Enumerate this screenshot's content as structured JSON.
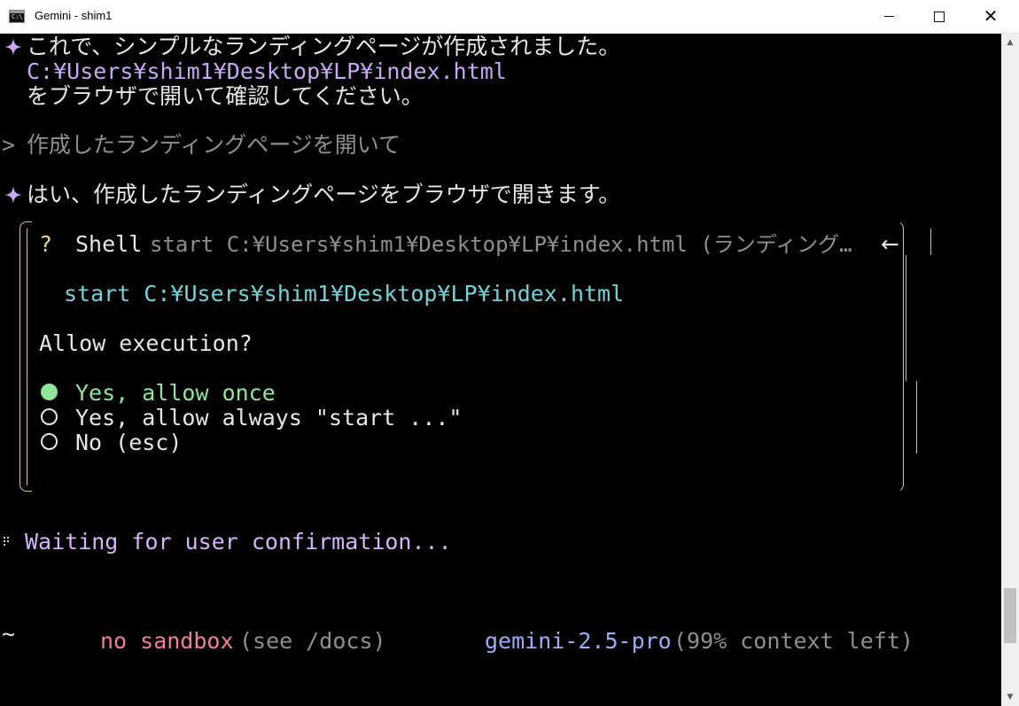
{
  "window": {
    "title": "Gemini - shim1",
    "minimize_glyph": "",
    "maximize_glyph": "",
    "close_glyph": "✕"
  },
  "terminal": {
    "message1": {
      "line1": "これで、シンプルなランディングページが作成されました。",
      "path": "C:¥Users¥shim1¥Desktop¥LP¥index.html",
      "line3": "をブラウザで開いて確認してください。"
    },
    "user_prompt": {
      "marker": ">",
      "text": "作成したランディングページを開いて"
    },
    "message2": "はい、作成したランディングページをブラウザで開きます。",
    "dialog": {
      "question_mark": "?",
      "tool_name": "Shell",
      "tool_description": "start C:¥Users¥shim1¥Desktop¥LP¥index.html (ランディング…",
      "arrow": "←",
      "command": "start C:¥Users¥shim1¥Desktop¥LP¥index.html",
      "question": "Allow execution?",
      "options": [
        {
          "label": "Yes, allow once",
          "selected": true
        },
        {
          "label": "Yes, allow always \"start ...\"",
          "selected": false
        },
        {
          "label": "No (esc)",
          "selected": false
        }
      ]
    },
    "status": "Waiting for user confirmation...",
    "footer": {
      "cwd": "~",
      "sandbox": "no sandbox",
      "sandbox_hint": "(see /docs)",
      "model": "gemini-2.5-pro",
      "context": "(99% context left)"
    }
  },
  "colors": {
    "background": "#000000",
    "text": "#e6e6e6",
    "accent_violet": "#c9a7f5",
    "command_cyan": "#74d3d8",
    "selected_green": "#8fe79a",
    "sandbox_pink": "#f27f96",
    "model_blue": "#99aef8",
    "dialog_border": "#d9c39c"
  }
}
